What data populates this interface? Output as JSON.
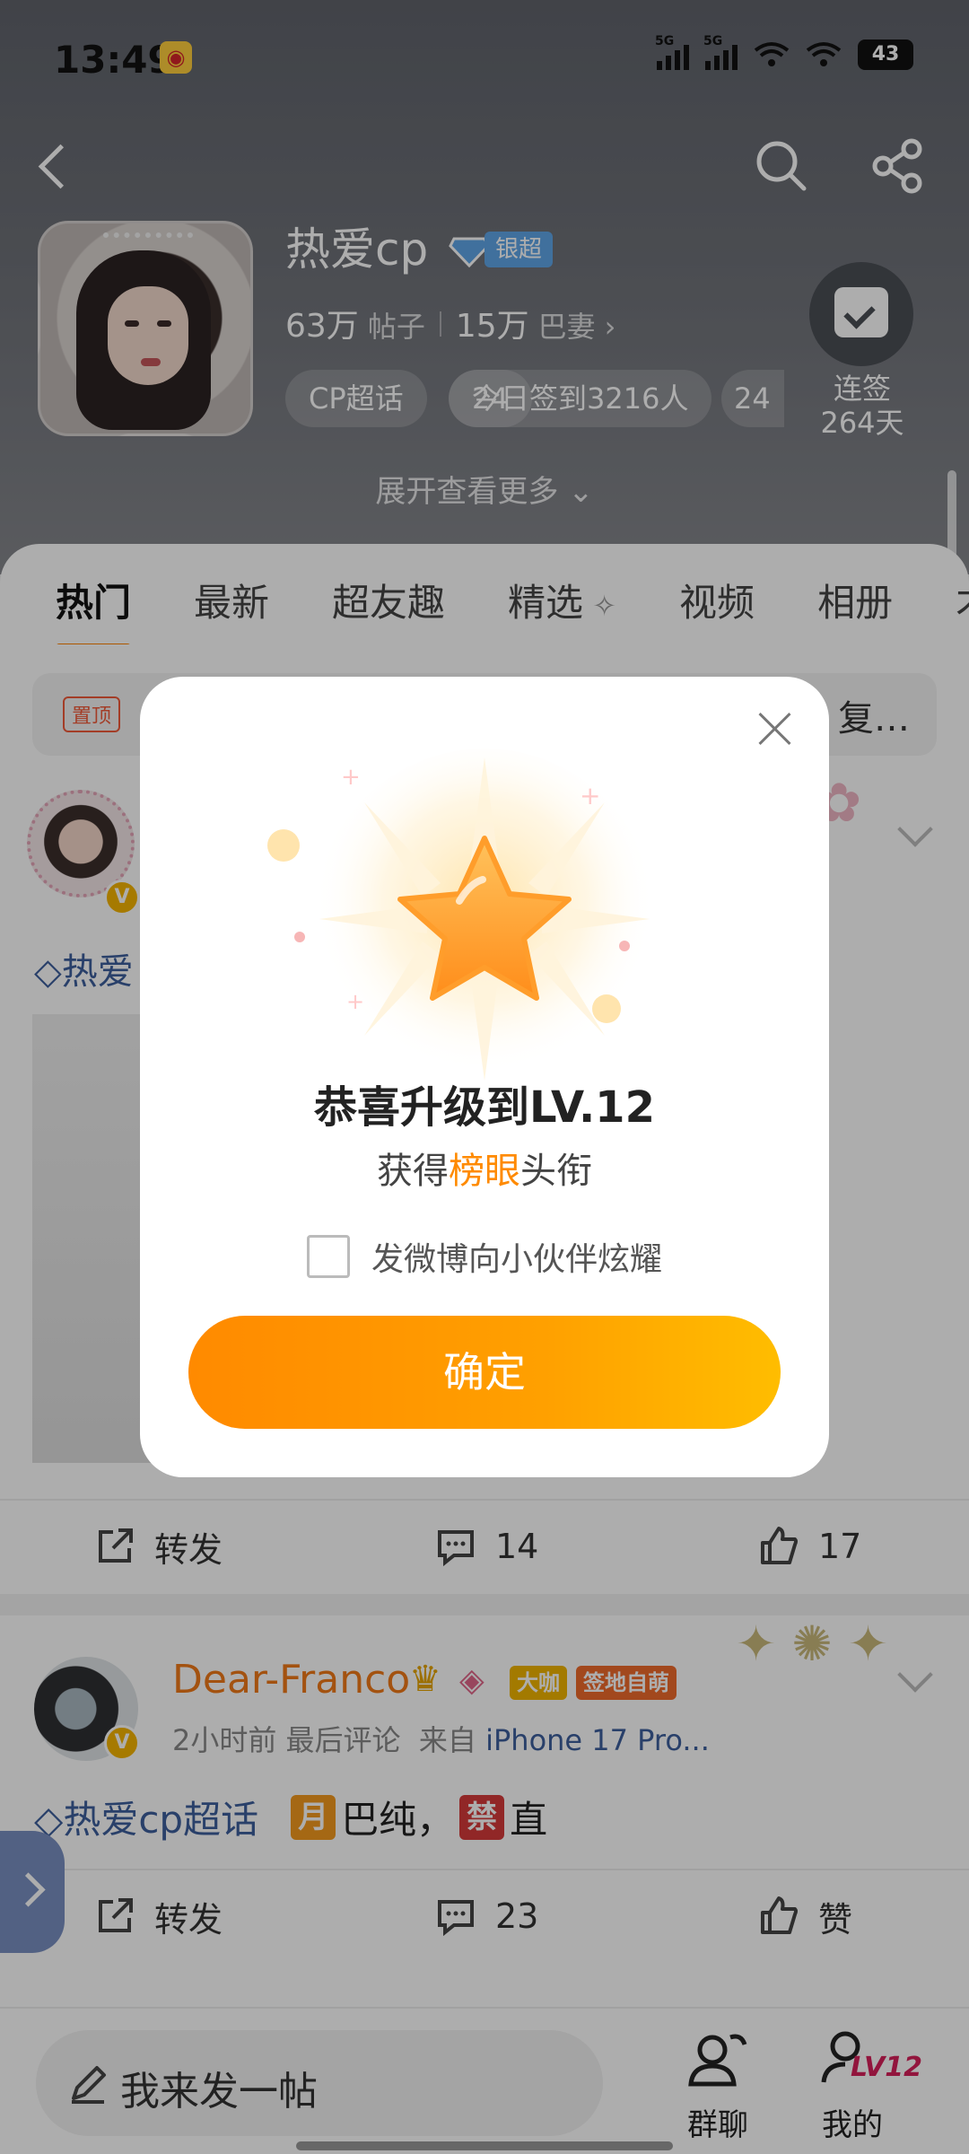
{
  "status_bar": {
    "time": "13:49",
    "network1": "5G",
    "network2": "5G",
    "battery": "43"
  },
  "header": {
    "topic_name": "热爱cp",
    "level_badge": "银超",
    "posts_count": "63万",
    "posts_unit": "帖子",
    "fans_count": "15万",
    "fans_unit": "巴妻",
    "chips": [
      "CP超话",
      "今日签到3216人",
      "24"
    ],
    "checkin_label": "连签",
    "checkin_days": "264天",
    "expand_label": "展开查看更多"
  },
  "tabs": [
    "热门",
    "最新",
    "超友趣",
    "精选",
    "视频",
    "相册",
    "才"
  ],
  "pinned": {
    "tag": "置顶",
    "text": "复…"
  },
  "post1": {
    "topic": "热爱"
  },
  "post1_actions": {
    "repost": "转发",
    "comments": "14",
    "likes": "17"
  },
  "post2": {
    "name": "Dear-Franco",
    "badge1": "大咖",
    "badge2": "签地自萌",
    "time": "2小时前",
    "last_comment": "最后评论",
    "from_label": "来自",
    "source": "iPhone 17 Pro...",
    "topic": "热爱cp超话",
    "emoji1": "月",
    "text1": "巴纯，",
    "emoji2": "禁",
    "text2": "直"
  },
  "post2_actions": {
    "repost": "转发",
    "comments": "23",
    "likes": "赞"
  },
  "bottom_bar": {
    "compose_placeholder": "我来发一帖",
    "group_label": "群聊",
    "my_label": "我的",
    "my_level": "LV12"
  },
  "dialog": {
    "title": "恭喜升级到LV.12",
    "sub_prefix": "获得",
    "sub_highlight": "榜眼",
    "sub_suffix": "头衔",
    "share_label": "发微博向小伙伴炫耀",
    "share_checked": false,
    "confirm_label": "确定"
  },
  "colors": {
    "accent": "#ff8200",
    "link": "#3d5f9d",
    "name_orange": "#f07a18"
  }
}
